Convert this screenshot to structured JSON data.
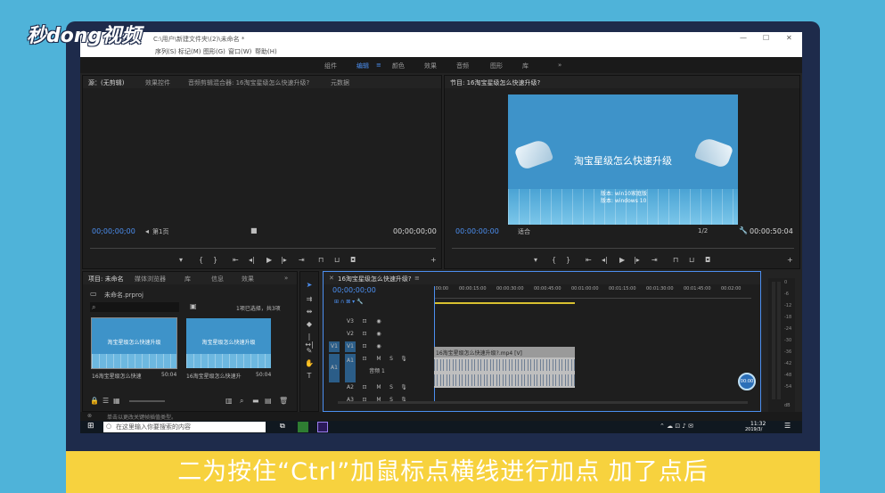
{
  "watermark": {
    "logo_text": "秒dong视频"
  },
  "app": {
    "title": "C:\\用户\\新建文件夹\\(2)\\未命名 *",
    "menu": [
      "序列(S)",
      "标记(M)",
      "图形(G)",
      "窗口(W)",
      "帮助(H)"
    ]
  },
  "workspaces": {
    "items": [
      "组件",
      "编辑",
      "颜色",
      "效果",
      "音频",
      "图形",
      "库"
    ],
    "active": "编辑",
    "more": "»"
  },
  "source_panel": {
    "tabs": [
      "源：(无剪辑)",
      "效果控件",
      "音频剪辑混合器: 16淘宝星级怎么快速升级?",
      "元数据"
    ],
    "timecode_left": "00;00;00;00",
    "page": "第1页",
    "timecode_right": "00;00;00;00"
  },
  "program_panel": {
    "title": "节目: 16淘宝星级怎么快速升级?",
    "timecode_left": "00:00:00:00",
    "fit": "适合",
    "scale": "1/2",
    "timecode_right": "00:00:50:04",
    "preview": {
      "title": "淘宝星级怎么快速升级",
      "line1": "版本: win10家庭版",
      "line2": "版本: windows 10"
    }
  },
  "project_panel": {
    "tabs": [
      "项目: 未命名",
      "媒体浏览器",
      "库",
      "信息",
      "效果"
    ],
    "file": "未命名.prproj",
    "selection": "1项已选择，共3项",
    "items": [
      {
        "name": "16淘宝星级怎么快速",
        "duration": "50:04"
      },
      {
        "name": "16淘宝星级怎么快速升",
        "duration": "50:04"
      }
    ]
  },
  "timeline": {
    "title": "16淘宝星级怎么快速升级?",
    "timecode": "00;00;00;00",
    "ruler": [
      ":00:00",
      "00:00:15:00",
      "00:00:30:00",
      "00:00:45:00",
      "00:01:00:00",
      "00:01:15:00",
      "00:01:30:00",
      "00:01:45:00",
      "00:02:00"
    ],
    "tracks": [
      "V3",
      "V2",
      "V1",
      "A1",
      "A2",
      "A3"
    ],
    "video_clip": "16淘宝星级怎么快速升级?.mp4 [V]",
    "audio_label": "音频 1",
    "meter_scale": [
      "0",
      "-6",
      "-12",
      "-18",
      "-24",
      "-30",
      "-36",
      "-42",
      "-48",
      "-54",
      "dB"
    ],
    "bubble": "00:00"
  },
  "status_bar": {
    "text": "单击以更改关键帧插值类型。"
  },
  "taskbar": {
    "search_placeholder": "在这里输入你要搜索的内容",
    "time": "11:32",
    "date": "2019/3/"
  },
  "caption": "二为按住“Ctrl”加鼠标点横线进行加点 加了点后"
}
